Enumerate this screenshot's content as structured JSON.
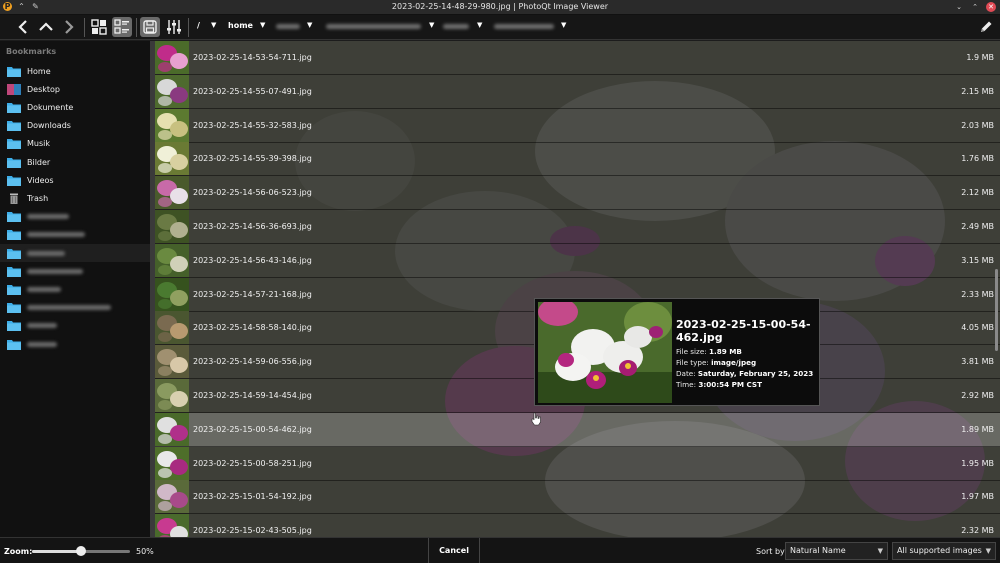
{
  "window": {
    "title": "2023-02-25-14-48-29-980.jpg | PhotoQt Image Viewer",
    "app_icon": "photoqt-icon"
  },
  "toolbar": {
    "back_icon": "chevron-left-icon",
    "up_icon": "chevron-up-icon",
    "forward_icon": "chevron-right-icon",
    "breadcrumbs": [
      "/",
      "home"
    ],
    "crumb_arrow": "▼"
  },
  "sidebar": {
    "header": "Bookmarks",
    "items": [
      {
        "label": "Home",
        "icon": "folder-icon"
      },
      {
        "label": "Desktop",
        "icon": "desktop-icon"
      },
      {
        "label": "Dokumente",
        "icon": "folder-icon"
      },
      {
        "label": "Downloads",
        "icon": "folder-icon"
      },
      {
        "label": "Musik",
        "icon": "folder-icon"
      },
      {
        "label": "Bilder",
        "icon": "folder-icon"
      },
      {
        "label": "Videos",
        "icon": "folder-icon"
      },
      {
        "label": "Trash",
        "icon": "trash-icon"
      }
    ]
  },
  "files": [
    {
      "name": "2023-02-25-14-53-54-711.jpg",
      "size": "1.9 MB"
    },
    {
      "name": "2023-02-25-14-55-07-491.jpg",
      "size": "2.15 MB"
    },
    {
      "name": "2023-02-25-14-55-32-583.jpg",
      "size": "2.03 MB"
    },
    {
      "name": "2023-02-25-14-55-39-398.jpg",
      "size": "1.76 MB"
    },
    {
      "name": "2023-02-25-14-56-06-523.jpg",
      "size": "2.12 MB"
    },
    {
      "name": "2023-02-25-14-56-36-693.jpg",
      "size": "2.49 MB"
    },
    {
      "name": "2023-02-25-14-56-43-146.jpg",
      "size": "3.15 MB"
    },
    {
      "name": "2023-02-25-14-57-21-168.jpg",
      "size": "2.33 MB"
    },
    {
      "name": "2023-02-25-14-58-58-140.jpg",
      "size": "4.05 MB"
    },
    {
      "name": "2023-02-25-14-59-06-556.jpg",
      "size": "3.81 MB"
    },
    {
      "name": "2023-02-25-14-59-14-454.jpg",
      "size": "2.92 MB"
    },
    {
      "name": "2023-02-25-15-00-54-462.jpg",
      "size": "1.89 MB"
    },
    {
      "name": "2023-02-25-15-00-58-251.jpg",
      "size": "1.95 MB"
    },
    {
      "name": "2023-02-25-15-01-54-192.jpg",
      "size": "1.97 MB"
    },
    {
      "name": "2023-02-25-15-02-43-505.jpg",
      "size": "2.32 MB"
    }
  ],
  "tooltip": {
    "filename": "2023-02-25-15-00-54-462.jpg",
    "size_label": "File size:",
    "size_value": "1.89 MB",
    "type_label": "File type:",
    "type_value": "image/jpeg",
    "date_label": "Date:",
    "date_value": "Saturday, February 25, 2023",
    "time_label": "Time:",
    "time_value": "3:00:54 PM CST"
  },
  "statusbar": {
    "zoom_label": "Zoom:",
    "zoom_value": "50%",
    "zoom_fraction": 0.5,
    "cancel_label": "Cancel",
    "sort_label": "Sort by:",
    "sort_value": "Natural Name",
    "filter_value": "All supported images"
  },
  "colors": {
    "folder": "#3daee9",
    "highlight_row": "rgba(255,255,255,0.22)",
    "close_button": "#e04a55"
  }
}
